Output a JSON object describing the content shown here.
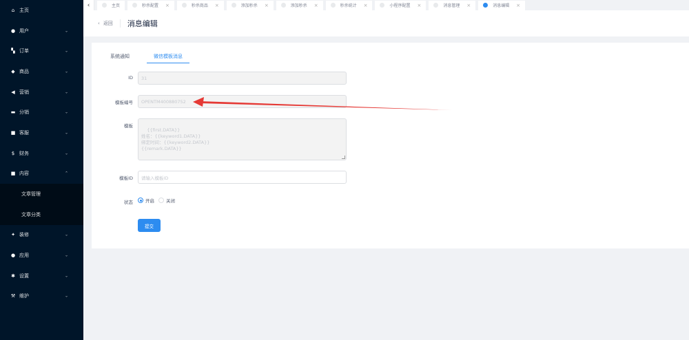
{
  "sidebar": {
    "items": [
      {
        "label": "主页",
        "icon": "home-icon",
        "glyph": "⌂",
        "arrow": ""
      },
      {
        "label": "用户",
        "icon": "user-icon",
        "glyph": "●",
        "arrow": "⌄"
      },
      {
        "label": "订单",
        "icon": "cart-icon",
        "glyph": "▚",
        "arrow": "⌄"
      },
      {
        "label": "商品",
        "icon": "goods-icon",
        "glyph": "◆",
        "arrow": "⌄"
      },
      {
        "label": "营销",
        "icon": "marketing-icon",
        "glyph": "◀",
        "arrow": "⌄"
      },
      {
        "label": "分销",
        "icon": "distribution-icon",
        "glyph": "▬",
        "arrow": "⌄"
      },
      {
        "label": "客服",
        "icon": "service-icon",
        "glyph": "■",
        "arrow": "⌄"
      },
      {
        "label": "财务",
        "icon": "finance-icon",
        "glyph": "$",
        "arrow": "⌄"
      },
      {
        "label": "内容",
        "icon": "content-icon",
        "glyph": "■",
        "arrow": "⌃"
      }
    ],
    "sub_items": [
      {
        "label": "文章管理"
      },
      {
        "label": "文章分类"
      }
    ],
    "items_after": [
      {
        "label": "装修",
        "icon": "decoration-icon",
        "glyph": "✦",
        "arrow": "⌄"
      },
      {
        "label": "应用",
        "icon": "app-icon",
        "glyph": "●",
        "arrow": "⌄"
      },
      {
        "label": "设置",
        "icon": "settings-icon",
        "glyph": "✱",
        "arrow": "⌄"
      },
      {
        "label": "维护",
        "icon": "maintenance-icon",
        "glyph": "⚒",
        "arrow": "⌄"
      }
    ]
  },
  "tabs": {
    "prev_glyph": "‹",
    "close_glyph": "×",
    "items": [
      {
        "label": "主页",
        "active": false,
        "closable": false
      },
      {
        "label": "秒杀配置",
        "active": false,
        "closable": true
      },
      {
        "label": "秒杀商品",
        "active": false,
        "closable": true
      },
      {
        "label": "添加秒杀",
        "active": false,
        "closable": true
      },
      {
        "label": "添加秒杀",
        "active": false,
        "closable": true
      },
      {
        "label": "秒杀统计",
        "active": false,
        "closable": true
      },
      {
        "label": "小程序配置",
        "active": false,
        "closable": true
      },
      {
        "label": "消息管理",
        "active": false,
        "closable": true
      },
      {
        "label": "消息编辑",
        "active": true,
        "closable": true
      }
    ]
  },
  "header": {
    "back_glyph": "‹",
    "back_label": "返回",
    "title": "消息编辑"
  },
  "card": {
    "tabs": [
      "系统通知",
      "微信模板消息"
    ],
    "active_tab": 1,
    "form": {
      "id_label": "ID",
      "id_value": "31",
      "template_no_label": "模板编号",
      "template_no_value": "OPENTM400880752",
      "template_label": "模板",
      "template_value": "{{first.DATA}}\n姓名：{{keyword1.DATA}}\n绑定时间：{{keyword2.DATA}}\n{{remark.DATA}}",
      "template_id_label": "模板ID",
      "template_id_placeholder": "请输入模板ID",
      "status_label": "状态",
      "status_on": "开启",
      "status_off": "关闭",
      "status_value": "开启",
      "submit_label": "提交"
    }
  },
  "colors": {
    "sidebar_bg": "#001529",
    "primary": "#2d8cf0",
    "annotation_arrow": "#e53935"
  }
}
